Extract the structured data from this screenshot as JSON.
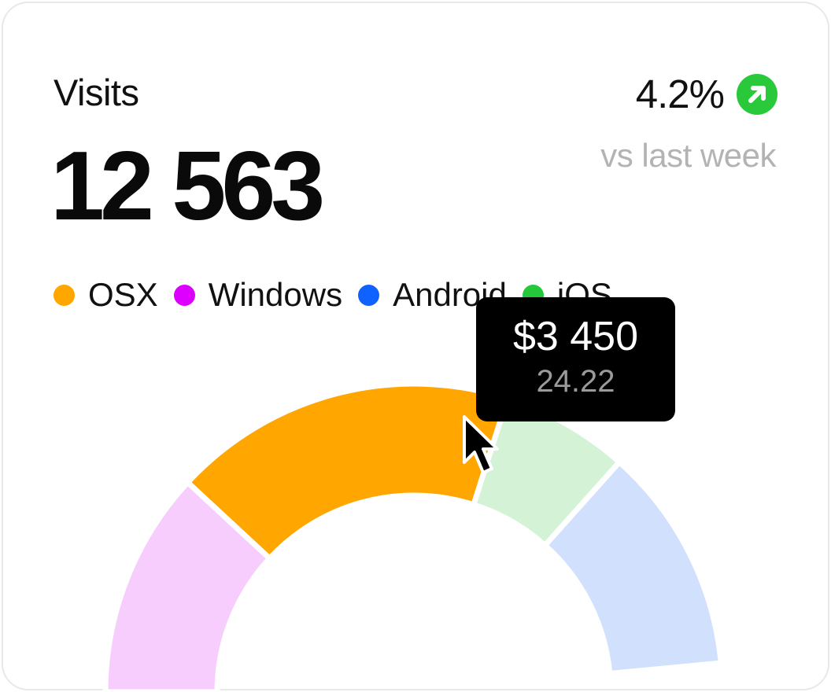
{
  "card": {
    "title": "Visits",
    "total": "12 563",
    "change": "4.2%",
    "change_caption": "vs last week",
    "change_icon": "arrow-up-right-icon",
    "change_color": "#2ac93b"
  },
  "legend": [
    {
      "label": "OSX",
      "color": "#ffa600"
    },
    {
      "label": "Windows",
      "color": "#dd00ff"
    },
    {
      "label": "Android",
      "color": "#0f62fe"
    },
    {
      "label": "iOS",
      "color": "#24c83a"
    }
  ],
  "tooltip": {
    "value": "$3 450",
    "sub": "24.22"
  },
  "chart_data": {
    "type": "pie",
    "variant": "semi-donut",
    "categories": [
      "Windows",
      "OSX",
      "iOS",
      "Android"
    ],
    "values": [
      16,
      24.22,
      9,
      16
    ],
    "colors": [
      "#f7cdfd",
      "#ffa600",
      "#d3f2d6",
      "#d1e0fd"
    ],
    "highlighted": "OSX"
  }
}
